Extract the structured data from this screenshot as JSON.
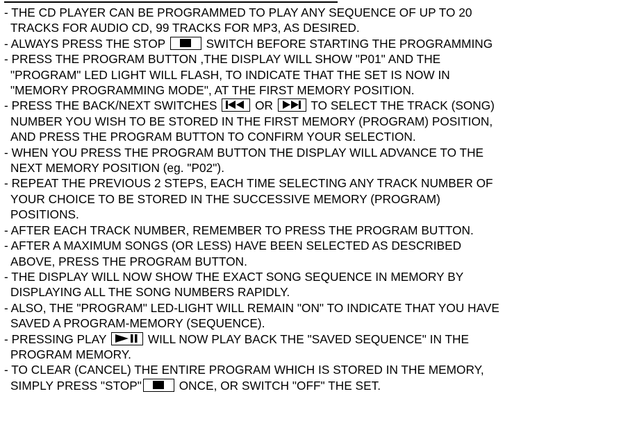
{
  "paragraphs": [
    {
      "lines": [
        {
          "text": "- THE CD PLAYER CAN BE PROGRAMMED TO PLAY ANY SEQUENCE OF UP TO 20"
        },
        {
          "text": "TRACKS FOR AUDIO CD, 99 TRACKS FOR MP3, AS DESIRED."
        }
      ]
    },
    {
      "lines": [
        {
          "parts": [
            "- ALWAYS PRESS THE STOP ",
            "SWITCH BEFORE STARTING THE PROGRAMMING"
          ]
        }
      ]
    },
    {
      "lines": [
        {
          "text": "- PRESS THE PROGRAM BUTTON ,THE DISPLAY WILL SHOW \"P01\" AND THE"
        },
        {
          "text": "\"PROGRAM\" LED LIGHT WILL FLASH, TO INDICATE THAT THE SET IS NOW IN"
        },
        {
          "text": "\"MEMORY PROGRAMMING MODE\", AT THE FIRST MEMORY POSITION."
        }
      ]
    },
    {
      "lines": [
        {
          "parts": [
            "- PRESS THE BACK/NEXT SWITCHES ",
            " OR ",
            " TO SELECT THE TRACK (SONG)"
          ]
        },
        {
          "text": "NUMBER YOU WISH TO BE STORED IN THE FIRST MEMORY (PROGRAM) POSITION,"
        },
        {
          "text": "AND PRESS THE PROGRAM BUTTON TO CONFIRM YOUR SELECTION."
        }
      ]
    },
    {
      "lines": [
        {
          "text": "- WHEN YOU PRESS  THE PROGRAM BUTTON THE DISPLAY WILL ADVANCE TO THE"
        },
        {
          "text": "NEXT MEMORY POSITION (eg. \"P02\")."
        }
      ]
    },
    {
      "lines": [
        {
          "text": "- REPEAT THE PREVIOUS 2 STEPS, EACH TIME SELECTING ANY TRACK NUMBER OF"
        },
        {
          "text": "YOUR CHOICE TO BE STORED IN THE SUCCESSIVE MEMORY (PROGRAM)"
        },
        {
          "text": "POSITIONS."
        }
      ]
    },
    {
      "lines": [
        {
          "text": "- AFTER EACH TRACK NUMBER, REMEMBER TO PRESS THE PROGRAM BUTTON."
        }
      ]
    },
    {
      "lines": [
        {
          "text": "- AFTER A MAXIMUM SONGS (OR LESS) HAVE BEEN SELECTED AS DESCRIBED"
        },
        {
          "text": "ABOVE, PRESS THE PROGRAM BUTTON."
        }
      ]
    },
    {
      "lines": [
        {
          "text": "- THE DISPLAY WILL NOW SHOW THE EXACT SONG SEQUENCE IN MEMORY BY"
        },
        {
          "text": "DISPLAYING ALL THE SONG NUMBERS RAPIDLY."
        }
      ]
    },
    {
      "lines": [
        {
          "text": "- ALSO, THE \"PROGRAM\" LED-LIGHT WILL REMAIN \"ON\" TO INDICATE THAT YOU HAVE"
        },
        {
          "text": "SAVED A PROGRAM-MEMORY (SEQUENCE)."
        }
      ]
    },
    {
      "lines": [
        {
          "parts": [
            "- PRESSING PLAY ",
            " WILL NOW PLAY BACK THE \"SAVED SEQUENCE\" IN THE"
          ]
        },
        {
          "text": "PROGRAM MEMORY."
        }
      ]
    },
    {
      "lines": [
        {
          "text": "- TO CLEAR (CANCEL) THE ENTIRE PROGRAM WHICH IS STORED IN THE MEMORY,"
        },
        {
          "parts": [
            "SIMPLY PRESS \"STOP\"",
            " ONCE, OR SWITCH \"OFF\" THE SET."
          ]
        }
      ]
    }
  ],
  "icons": {
    "stop": "stop-icon",
    "back": "skip-back-icon",
    "next": "skip-next-icon",
    "playpause": "play-pause-icon"
  }
}
